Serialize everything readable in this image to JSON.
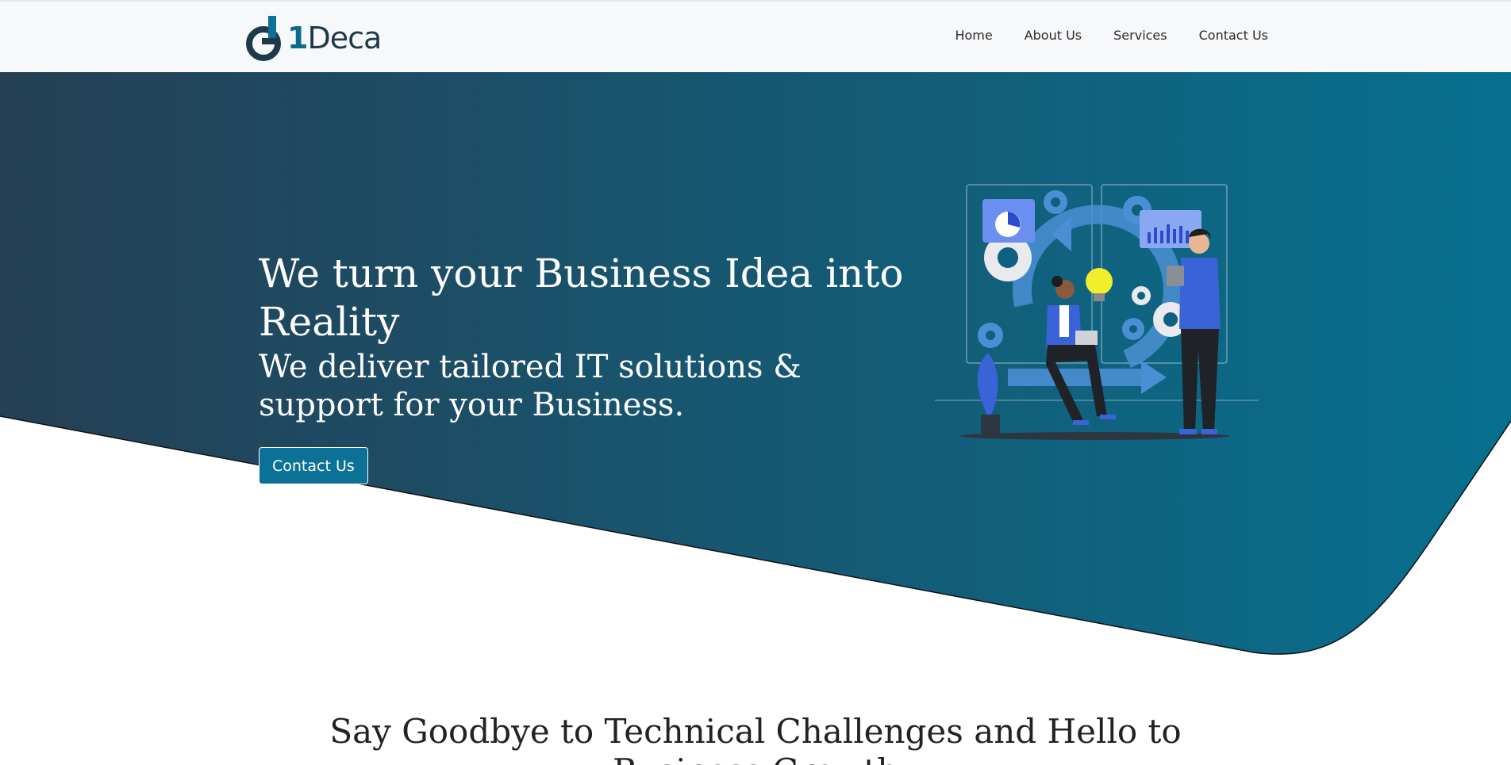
{
  "brand": {
    "name_prefix": "1",
    "name_suffix": "Deca"
  },
  "nav": {
    "items": [
      {
        "label": "Home"
      },
      {
        "label": "About Us"
      },
      {
        "label": "Services"
      },
      {
        "label": "Contact Us"
      }
    ]
  },
  "hero": {
    "title": "We turn your Business Idea into Reality",
    "subtitle": "We deliver tailored IT solutions & support for your Business.",
    "cta_label": "Contact Us"
  },
  "section": {
    "heading": "Say Goodbye to Technical Challenges and Hello to Business Growth"
  },
  "colors": {
    "gradient_start": "#253f54",
    "gradient_end": "#07708f",
    "accent": "#0b7196",
    "illustration_blue": "#3f7de8"
  },
  "icons": [
    "logo-mark-icon",
    "hero-illustration"
  ]
}
